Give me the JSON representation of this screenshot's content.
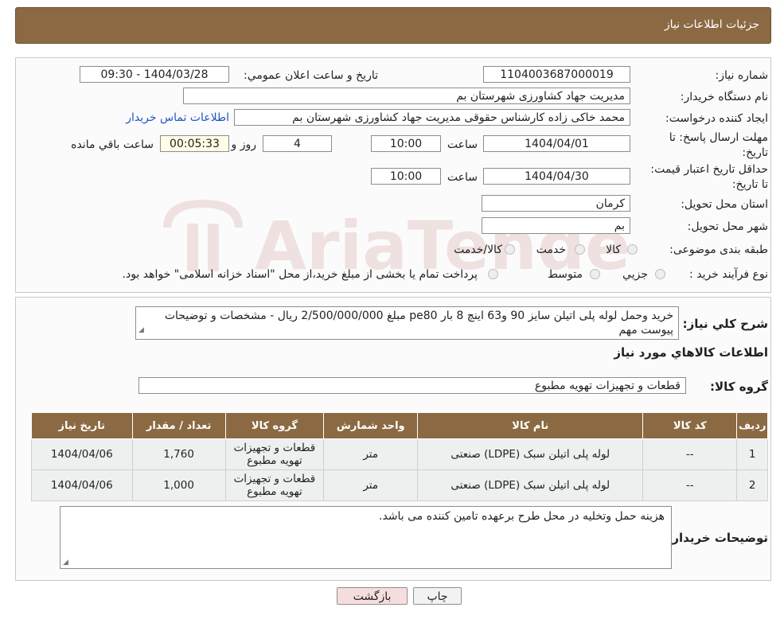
{
  "header": {
    "title": "جزئیات اطلاعات نیاز"
  },
  "form": {
    "need_number_label": "شماره نیاز:",
    "need_number": "1104003687000019",
    "announce_label": "تاریخ و ساعت اعلان عمومي:",
    "announce_value": "1404/03/28 - 09:30",
    "buyer_org_label": "نام دستگاه خريدار:",
    "buyer_org": "مدیریت جهاد کشاورزی شهرستان بم",
    "creator_label": "ايجاد كننده درخواست:",
    "creator": "محمد خاکی زاده کارشناس حقوقی مدیریت جهاد کشاورزی شهرستان بم",
    "contact_link": "اطلاعات تماس خريدار",
    "deadline_label": "مهلت ارسال پاسخ: تا تاریخ:",
    "deadline_date": "1404/04/01",
    "time_label": "ساعت",
    "deadline_time": "10:00",
    "days": "4",
    "days_label": "روز و",
    "remaining": "00:05:33",
    "remaining_label": "ساعت باقي مانده",
    "validity_label": "حداقل تاريخ اعتبار قيمت: تا تاریخ:",
    "validity_date": "1404/04/30",
    "validity_time": "10:00",
    "province_label": "استان محل تحویل:",
    "province": "کرمان",
    "city_label": "شهر محل تحویل:",
    "city": "بم",
    "category_label": "طبقه بندی موضوعی:",
    "category_options": [
      "کالا",
      "خدمت",
      "کالا/خدمت"
    ],
    "process_label": "نوع فرآيند خريد :",
    "process_options": [
      "جزيي",
      "متوسط"
    ],
    "process_note": "پرداخت تمام یا بخشی از مبلغ خرید،از محل \"اسناد خزانه اسلامی\" خواهد بود."
  },
  "watermark": {
    "text": "AriaTender.neT"
  },
  "summary": {
    "label": "شرح کلي نياز:",
    "text": "خرید وحمل لوله پلی اتیلن سایز 90 و63 اینچ 8 بار pe80 مبلغ 2/500/000/000 ریال - مشخصات و توضیحات پیوست مهم"
  },
  "goods": {
    "section_title": "اطلاعات کالاهاي مورد نياز",
    "group_label": "گروه کالا:",
    "group_value": "قطعات و تجهیزات تهویه مطبوع",
    "columns": [
      "رديف",
      "کد کالا",
      "نام کالا",
      "واحد شمارش",
      "گروه کالا",
      "تعداد / مقدار",
      "تاريخ نياز"
    ],
    "rows": [
      [
        "1",
        "--",
        "لوله پلی اتیلن سبک (LDPE) صنعتی",
        "متر",
        "قطعات و تجهیزات تهویه مطبوع",
        "1,760",
        "1404/04/06"
      ],
      [
        "2",
        "--",
        "لوله پلی اتیلن سبک (LDPE) صنعتی",
        "متر",
        "قطعات و تجهیزات تهویه مطبوع",
        "1,000",
        "1404/04/06"
      ]
    ]
  },
  "buyer_notes": {
    "label": "توضيحات خريدار:",
    "text": "هزینه حمل وتخلیه در محل طرح برعهده تامین کننده می باشد."
  },
  "buttons": {
    "print": "چاپ",
    "back": "بازگشت"
  }
}
